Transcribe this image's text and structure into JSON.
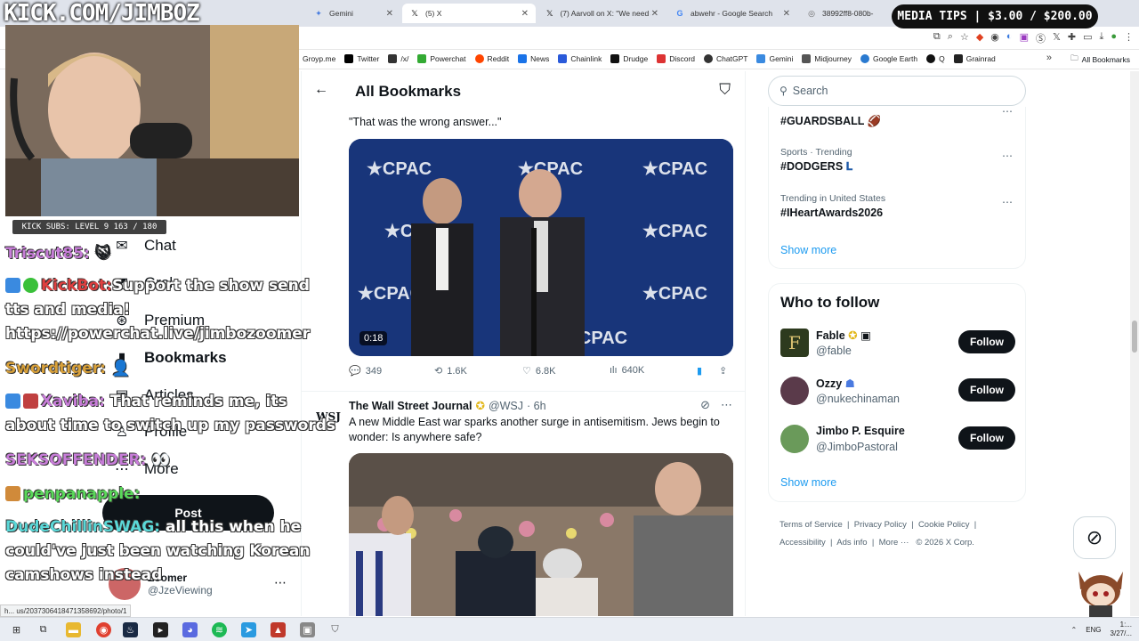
{
  "browser": {
    "tabs": [
      {
        "label": "Gemini",
        "icon": "gemini-icon"
      },
      {
        "label": "(5) X",
        "icon": "x-logo-icon"
      },
      {
        "label": "(7) Aarvoll on X: \"We need a",
        "icon": "x-logo-icon"
      },
      {
        "label": "abwehr - Google Search",
        "icon": "google-icon"
      },
      {
        "label": "38992ff8-080b-",
        "icon": "globe-icon"
      }
    ],
    "bookmarks": [
      "Groyp.me",
      "Twitter",
      "/x/",
      "Powerchat",
      "Reddit",
      "News",
      "Chainlink",
      "Drudge",
      "Discord",
      "ChatGPT",
      "Gemini",
      "Midjourney",
      "Google Earth",
      "Q",
      "Grainrad"
    ],
    "all_bookmarks": "All Bookmarks"
  },
  "nav": {
    "items": [
      {
        "label": "Chat",
        "icon": "chat-icon"
      },
      {
        "label": "Grok",
        "icon": "grok-icon"
      },
      {
        "label": "Premium",
        "icon": "premium-icon"
      },
      {
        "label": "Bookmarks",
        "icon": "bookmark-icon"
      },
      {
        "label": "Articles",
        "icon": "articles-icon"
      },
      {
        "label": "Profile",
        "icon": "profile-icon"
      },
      {
        "label": "More",
        "icon": "more-icon"
      }
    ],
    "post_label": "Post",
    "account": {
      "name": "Zoomer",
      "handle": "@JzeViewing"
    }
  },
  "main": {
    "title": "All Bookmarks",
    "tweet1": {
      "text": "\"That was the wrong answer...\"",
      "video_time": "0:18",
      "replies": "349",
      "reposts": "1.6K",
      "likes": "6.8K",
      "views": "640K"
    },
    "tweet2": {
      "avatar_text": "WSJ",
      "name": "The Wall Street Journal",
      "handle": "@WSJ",
      "time": "· 6h",
      "text": "A new Middle East war sparks another surge in antisemitism. Jews begin to wonder: Is anywhere safe?"
    }
  },
  "sidebar": {
    "search_placeholder": "Search",
    "trends": [
      {
        "meta": "",
        "tag": "#GUARDSBALL 🏈"
      },
      {
        "meta": "Sports · Trending",
        "tag": "#DODGERS"
      },
      {
        "meta": "Trending in United States",
        "tag": "#IHeartAwards2026"
      }
    ],
    "show_more": "Show more",
    "who_to_follow": {
      "title": "Who to follow",
      "users": [
        {
          "name": "Fable",
          "handle": "@fable",
          "button": "Follow",
          "avatar_color": "#2d3a1e"
        },
        {
          "name": "Ozzy",
          "handle": "@nukechinaman",
          "button": "Follow",
          "avatar_color": "#5a3a4a"
        },
        {
          "name": "Jimbo P. Esquire",
          "handle": "@JimboPastoral",
          "button": "Follow",
          "avatar_color": "#6a9a5a"
        }
      ],
      "show_more": "Show more"
    },
    "footer": {
      "links": [
        "Terms of Service",
        "Privacy Policy",
        "Cookie Policy",
        "Accessibility",
        "Ads info",
        "More ···"
      ],
      "copyright": "© 2026 X Corp."
    }
  },
  "overlay": {
    "banner": "KICK.COM/JIMBOZ",
    "subs": "KICK SUBS: LEVEL 9 163 / 180",
    "tips": "MEDIA TIPS | $3.00 / $200.00",
    "chat": [
      {
        "user": "Triscut85:",
        "msg": "",
        "color": "#c77dd8"
      },
      {
        "user": "KickBot:",
        "msg": "Support the show send",
        "color": "#e04040"
      },
      {
        "user": "",
        "msg": "tts and media!",
        "color": "#fff"
      },
      {
        "user": "",
        "msg": "https://powerchat.live/jimbozoomer",
        "color": "#fff"
      },
      {
        "user": "Swordtiger:",
        "msg": "",
        "color": "#d9a13a"
      },
      {
        "user": "Xaviba:",
        "msg": "That reminds me, its",
        "color": "#c77dd8"
      },
      {
        "user": "",
        "msg": "about time to switch up my passwords",
        "color": "#fff"
      },
      {
        "user": "SEKSOFFENDER:",
        "msg": "",
        "color": "#c77dd8"
      },
      {
        "user": "penpanapple:",
        "msg": "",
        "color": "#5ad85a"
      },
      {
        "user": "DudeChillinSWAG:",
        "msg": "all this when he",
        "color": "#5ad8d8"
      },
      {
        "user": "",
        "msg": "could've just been watching Korean",
        "color": "#fff"
      },
      {
        "user": "",
        "msg": "camshows instead",
        "color": "#fff"
      }
    ]
  },
  "status_url": "h... us/2037306418471358692/photo/1",
  "taskbar": {
    "lang": "ENG",
    "time": "1:...",
    "date": "3/27/..."
  }
}
